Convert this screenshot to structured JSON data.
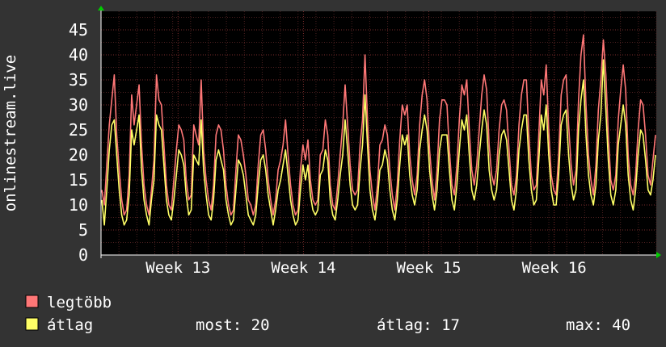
{
  "chart_data": {
    "type": "line",
    "ylabel": "onlinestream.live",
    "ylim": [
      0,
      48
    ],
    "yticks": [
      0,
      5,
      10,
      15,
      20,
      25,
      30,
      35,
      40,
      45
    ],
    "xticks": [
      "Week 13",
      "Week 14",
      "Week 15",
      "Week 16"
    ],
    "grid": true,
    "series": [
      {
        "name": "legtöbb",
        "color": "#ff7777",
        "values": [
          13,
          10,
          18,
          26,
          31,
          36,
          24,
          17,
          11,
          8,
          9,
          16,
          32,
          26,
          30,
          34,
          22,
          14,
          10,
          8,
          13,
          19,
          36,
          31,
          30,
          22,
          14,
          10,
          9,
          15,
          21,
          26,
          25,
          23,
          15,
          11,
          12,
          26,
          24,
          22,
          35,
          21,
          15,
          11,
          9,
          14,
          24,
          26,
          25,
          21,
          14,
          10,
          8,
          9,
          17,
          24,
          23,
          20,
          16,
          11,
          10,
          8,
          10,
          18,
          24,
          25,
          21,
          15,
          11,
          8,
          11,
          17,
          19,
          22,
          27,
          20,
          14,
          10,
          8,
          9,
          17,
          22,
          19,
          23,
          15,
          11,
          10,
          11,
          20,
          21,
          27,
          24,
          14,
          10,
          9,
          14,
          20,
          26,
          34,
          26,
          18,
          13,
          12,
          13,
          22,
          27,
          40,
          27,
          17,
          12,
          9,
          14,
          22,
          23,
          26,
          24,
          17,
          12,
          9,
          14,
          23,
          30,
          28,
          30,
          20,
          15,
          12,
          16,
          26,
          32,
          35,
          31,
          21,
          15,
          11,
          17,
          27,
          31,
          31,
          30,
          21,
          14,
          12,
          18,
          27,
          34,
          32,
          35,
          25,
          17,
          14,
          18,
          25,
          32,
          36,
          33,
          22,
          16,
          14,
          17,
          25,
          30,
          31,
          29,
          21,
          14,
          12,
          16,
          26,
          32,
          35,
          35,
          24,
          16,
          13,
          14,
          24,
          35,
          32,
          38,
          25,
          16,
          13,
          12,
          20,
          32,
          35,
          36,
          26,
          18,
          14,
          17,
          31,
          40,
          44,
          30,
          20,
          15,
          12,
          18,
          29,
          35,
          43,
          36,
          24,
          15,
          13,
          16,
          27,
          33,
          38,
          33,
          20,
          14,
          12,
          16,
          25,
          31,
          30,
          24,
          16,
          14,
          19,
          24
        ]
      },
      {
        "name": "átlag",
        "color": "#ffff66",
        "values": [
          11,
          6,
          13,
          21,
          26,
          27,
          20,
          13,
          8,
          6,
          7,
          12,
          25,
          22,
          25,
          28,
          17,
          11,
          8,
          6,
          11,
          15,
          28,
          26,
          25,
          18,
          11,
          8,
          7,
          11,
          16,
          21,
          20,
          18,
          12,
          8,
          9,
          20,
          19,
          18,
          27,
          17,
          12,
          8,
          7,
          11,
          19,
          21,
          19,
          17,
          11,
          8,
          6,
          7,
          13,
          19,
          18,
          16,
          12,
          8,
          7,
          6,
          8,
          14,
          19,
          20,
          17,
          12,
          9,
          6,
          9,
          13,
          15,
          18,
          21,
          16,
          11,
          8,
          6,
          7,
          13,
          18,
          15,
          18,
          12,
          9,
          8,
          9,
          16,
          17,
          21,
          19,
          11,
          8,
          7,
          11,
          16,
          20,
          27,
          21,
          14,
          10,
          9,
          10,
          17,
          22,
          32,
          22,
          13,
          9,
          7,
          11,
          17,
          18,
          21,
          19,
          13,
          9,
          7,
          11,
          18,
          24,
          22,
          24,
          16,
          12,
          10,
          13,
          21,
          25,
          28,
          25,
          17,
          12,
          9,
          13,
          21,
          24,
          24,
          24,
          17,
          11,
          9,
          14,
          21,
          27,
          25,
          28,
          20,
          13,
          11,
          14,
          20,
          25,
          29,
          26,
          17,
          13,
          11,
          13,
          20,
          24,
          25,
          23,
          17,
          11,
          9,
          13,
          21,
          25,
          28,
          28,
          19,
          13,
          10,
          11,
          19,
          28,
          25,
          30,
          20,
          13,
          10,
          10,
          16,
          26,
          28,
          29,
          20,
          14,
          11,
          13,
          25,
          31,
          35,
          24,
          16,
          12,
          10,
          14,
          23,
          28,
          39,
          29,
          19,
          12,
          10,
          13,
          22,
          26,
          30,
          26,
          16,
          11,
          9,
          13,
          20,
          25,
          24,
          19,
          13,
          12,
          15,
          20
        ]
      }
    ],
    "legend": {
      "placement": "bottom-left",
      "items": [
        {
          "label": "legtöbb",
          "color": "#ff7777"
        },
        {
          "label": "átlag",
          "color": "#ffff66"
        }
      ]
    },
    "stats": {
      "now": "most: 20",
      "avg": "átlag: 17",
      "max": "max: 40"
    }
  }
}
